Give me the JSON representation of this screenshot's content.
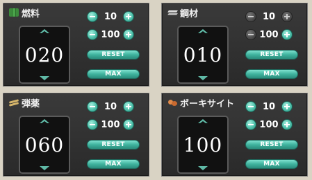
{
  "panels": [
    {
      "id": "fuel",
      "name": "燃料",
      "icon": "fuel-icon",
      "value": "020",
      "step_small": "10",
      "step_large": "100",
      "small_minus_enabled": true,
      "reset_label": "RESET",
      "max_label": "MAX"
    },
    {
      "id": "steel",
      "name": "鋼材",
      "icon": "steel-icon",
      "value": "010",
      "step_small": "10",
      "step_large": "100",
      "small_minus_enabled": false,
      "reset_label": "RESET",
      "max_label": "MAX"
    },
    {
      "id": "ammo",
      "name": "弾薬",
      "icon": "ammo-icon",
      "value": "060",
      "step_small": "10",
      "step_large": "100",
      "small_minus_enabled": true,
      "reset_label": "RESET",
      "max_label": "MAX"
    },
    {
      "id": "bauxite",
      "name": "ボーキサイト",
      "icon": "bauxite-icon",
      "value": "100",
      "step_small": "10",
      "step_large": "100",
      "small_minus_enabled": true,
      "reset_label": "RESET",
      "max_label": "MAX"
    }
  ],
  "colors": {
    "accent": "#4fc1ab",
    "panel_bg": "#2f2f2f",
    "page_bg": "#d9d3c4"
  }
}
